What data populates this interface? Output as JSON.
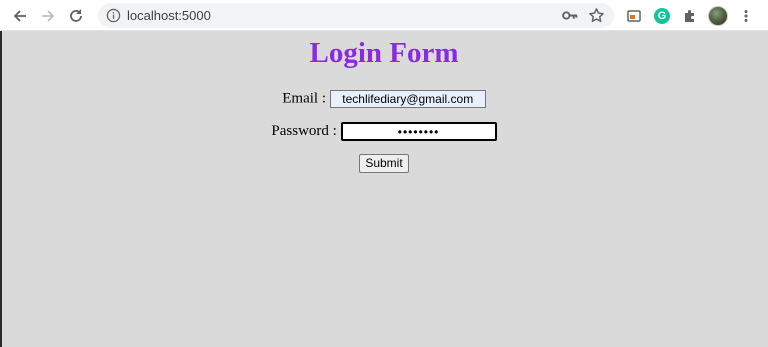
{
  "browser": {
    "url": "localhost:5000",
    "nav_icons": [
      "back-arrow-icon",
      "forward-arrow-icon",
      "reload-icon"
    ],
    "omnibox_icons": [
      "info-icon",
      "key-icon",
      "star-icon"
    ],
    "extension_icons": [
      "cast-icon",
      "grammarly-icon",
      "puzzle-icon",
      "profile-avatar",
      "kebab-menu-icon"
    ],
    "grammarly_letter": "G"
  },
  "page": {
    "title": "Login Form",
    "title_color": "#8a2be2",
    "background_color": "#dadada",
    "email": {
      "label": "Email :",
      "value": "techlifediary@gmail.com"
    },
    "password": {
      "label": "Password :",
      "masked_value": "••••••••"
    },
    "submit_label": "Submit"
  }
}
